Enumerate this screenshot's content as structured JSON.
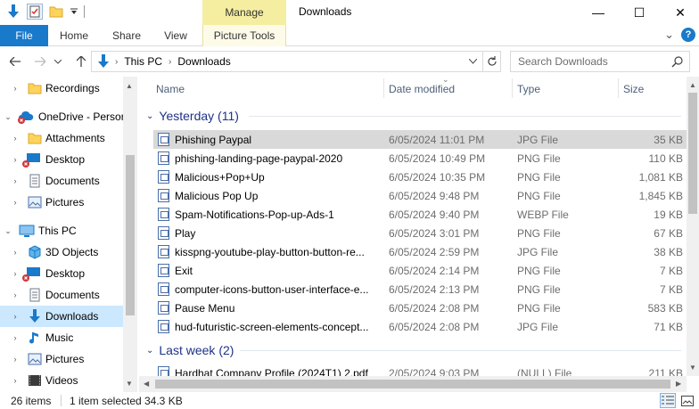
{
  "window": {
    "title": "Downloads",
    "manage_label": "Manage",
    "controls": {
      "minimize": "—",
      "maximize": "☐",
      "close": "✕"
    }
  },
  "ribbon": {
    "tabs": [
      "File",
      "Home",
      "Share",
      "View",
      "Picture Tools"
    ],
    "expand_symbol": "⌄",
    "help_symbol": "?"
  },
  "address": {
    "crumbs": [
      "This PC",
      "Downloads"
    ],
    "search_placeholder": "Search Downloads"
  },
  "nav_pane": {
    "items": [
      {
        "label": "Recordings",
        "icon": "folder-icon"
      },
      {
        "label": "OneDrive - Persor",
        "icon": "onedrive-cloud-icon"
      },
      {
        "label": "Attachments",
        "icon": "folder-icon"
      },
      {
        "label": "Desktop",
        "icon": "desktop-icon"
      },
      {
        "label": "Documents",
        "icon": "documents-icon"
      },
      {
        "label": "Pictures",
        "icon": "pictures-icon"
      },
      {
        "label": "This PC",
        "icon": "computer-icon"
      },
      {
        "label": "3D Objects",
        "icon": "3d-objects-icon"
      },
      {
        "label": "Desktop",
        "icon": "desktop-icon"
      },
      {
        "label": "Documents",
        "icon": "documents-icon"
      },
      {
        "label": "Downloads",
        "icon": "downloads-arrow-icon"
      },
      {
        "label": "Music",
        "icon": "music-note-icon"
      },
      {
        "label": "Pictures",
        "icon": "pictures-icon"
      },
      {
        "label": "Videos",
        "icon": "videos-icon"
      }
    ]
  },
  "columns": {
    "name": "Name",
    "date": "Date modified",
    "type": "Type",
    "size": "Size"
  },
  "groups": {
    "yesterday": "Yesterday (11)",
    "last_week": "Last week (2)"
  },
  "files_yesterday": [
    {
      "name": "Phishing Paypal",
      "date": "6/05/2024 11:01 PM",
      "type": "JPG File",
      "size": "35 KB"
    },
    {
      "name": "phishing-landing-page-paypal-2020",
      "date": "6/05/2024 10:49 PM",
      "type": "PNG File",
      "size": "110 KB"
    },
    {
      "name": "Malicious+Pop+Up",
      "date": "6/05/2024 10:35 PM",
      "type": "PNG File",
      "size": "1,081 KB"
    },
    {
      "name": "Malicious Pop Up",
      "date": "6/05/2024 9:48 PM",
      "type": "PNG File",
      "size": "1,845 KB"
    },
    {
      "name": "Spam-Notifications-Pop-up-Ads-1",
      "date": "6/05/2024 9:40 PM",
      "type": "WEBP File",
      "size": "19 KB"
    },
    {
      "name": "Play",
      "date": "6/05/2024 3:01 PM",
      "type": "PNG File",
      "size": "67 KB"
    },
    {
      "name": "kisspng-youtube-play-button-button-re...",
      "date": "6/05/2024 2:59 PM",
      "type": "JPG File",
      "size": "38 KB"
    },
    {
      "name": "Exit",
      "date": "6/05/2024 2:14 PM",
      "type": "PNG File",
      "size": "7 KB"
    },
    {
      "name": "computer-icons-button-user-interface-e...",
      "date": "6/05/2024 2:13 PM",
      "type": "PNG File",
      "size": "7 KB"
    },
    {
      "name": "Pause Menu",
      "date": "6/05/2024 2:08 PM",
      "type": "PNG File",
      "size": "583 KB"
    },
    {
      "name": "hud-futuristic-screen-elements-concept...",
      "date": "6/05/2024 2:08 PM",
      "type": "JPG File",
      "size": "71 KB"
    }
  ],
  "files_last_week": [
    {
      "name": "Hardhat Company Profile (2024T1) 2.pdf",
      "date": "2/05/2024 9:03 PM",
      "type": "(NULL) File",
      "size": "211 KB"
    }
  ],
  "status": {
    "item_count": "26 items",
    "selection": "1 item selected",
    "selection_size": "34.3 KB"
  },
  "colors": {
    "accent": "#1979ca",
    "selection": "#cce8ff",
    "row_selected": "#d9d9d9",
    "group_header": "#1e3287",
    "manage_tab": "#f5eea0"
  }
}
